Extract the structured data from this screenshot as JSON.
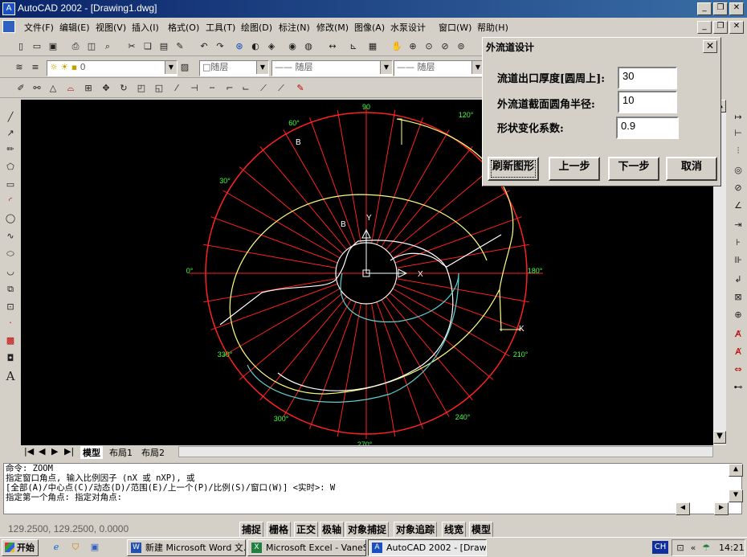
{
  "window": {
    "title": "AutoCAD 2002 - [Drawing1.dwg]"
  },
  "menu": [
    "文件(F)",
    "编辑(E)",
    "视图(V)",
    "插入(I)",
    "格式(O)",
    "工具(T)",
    "绘图(D)",
    "标注(N)",
    "修改(M)",
    "图像(A)",
    "水泵设计",
    "窗口(W)",
    "帮助(H)"
  ],
  "layer_toolbar": {
    "layer": "0",
    "color": "□随层",
    "linetype": "—— 随层",
    "lineweight": "—— 随层"
  },
  "dialog": {
    "title": "外流道设计",
    "fields": [
      {
        "label": "流道出口厚度[圆周上]:",
        "value": "30"
      },
      {
        "label": "外流道截面圆角半径:",
        "value": "10"
      },
      {
        "label": "形状变化系数:",
        "value": "0.9"
      }
    ],
    "buttons": [
      "刷新图形",
      "上一步",
      "下一步",
      "取消"
    ]
  },
  "drawing": {
    "angles": [
      "90",
      "60°",
      "120°",
      "30°",
      "0°",
      "180°",
      "330°",
      "210°",
      "300°",
      "240°",
      "270°"
    ],
    "labels": [
      "B",
      "B",
      "Y",
      "X",
      "K"
    ]
  },
  "layout_tabs": [
    "模型",
    "布局1",
    "布局2"
  ],
  "command_lines": [
    "命令: ZOOM",
    "指定窗口角点, 输入比例因子 (nX 或 nXP), 或",
    "[全部(A)/中心点(C)/动态(D)/范围(E)/上一个(P)/比例(S)/窗口(W)] <实时>: W",
    "指定第一个角点: 指定对角点:"
  ],
  "status": {
    "coords": "129.2500, 129.2500, 0.0000",
    "toggles": [
      "捕捉",
      "栅格",
      "正交",
      "极轴",
      "对象捕捉",
      "对象追踪",
      "线宽",
      "模型"
    ]
  },
  "taskbar": {
    "start": "开始",
    "tasks": [
      "新建 Microsoft Word 文...",
      "Microsoft Excel - VaneS...",
      "AutoCAD 2002 - [Drawi..."
    ],
    "lang": "CH",
    "time": "14:21"
  },
  "colors": {
    "title_bar": "#0a246a",
    "grid_red": "#ff2020",
    "curve_yellow": "#ffff80",
    "curve_cyan": "#60d0d0",
    "label_green": "#40ff40"
  }
}
